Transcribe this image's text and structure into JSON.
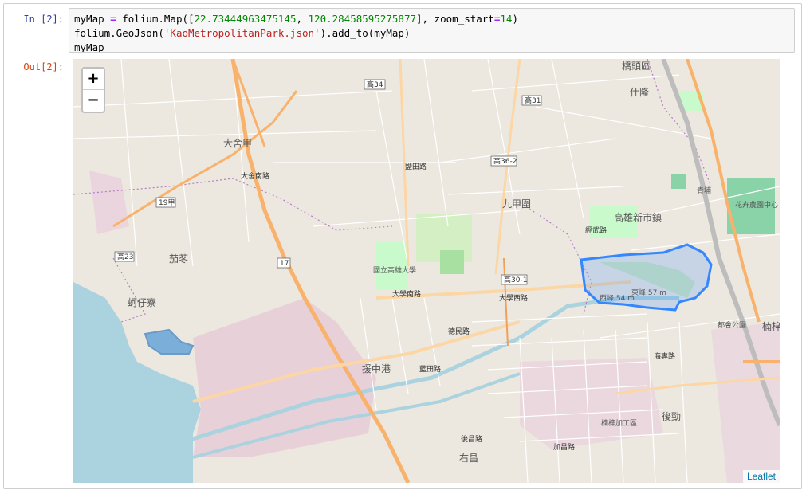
{
  "cell": {
    "in_prompt": "In [2]:",
    "out_prompt": "Out[2]:",
    "code_lines": [
      [
        {
          "t": "myMap ",
          "c": "var"
        },
        {
          "t": "=",
          "c": "kw-op"
        },
        {
          "t": " folium.Map([",
          "c": "var"
        },
        {
          "t": "22.73444963475145",
          "c": "num"
        },
        {
          "t": ", ",
          "c": "var"
        },
        {
          "t": "120.28458595275877",
          "c": "num"
        },
        {
          "t": "], zoom_start",
          "c": "var"
        },
        {
          "t": "=",
          "c": "kw-op"
        },
        {
          "t": "14",
          "c": "num"
        },
        {
          "t": ")",
          "c": "var"
        }
      ],
      [
        {
          "t": "folium.GeoJson(",
          "c": "var"
        },
        {
          "t": "'KaoMetropolitanPark.json'",
          "c": "str"
        },
        {
          "t": ").add_to(myMap)",
          "c": "var"
        }
      ],
      [
        {
          "t": "myMap",
          "c": "var"
        }
      ]
    ]
  },
  "map": {
    "zoom_in": "+",
    "zoom_out": "−",
    "attribution": "Leaflet",
    "colors": {
      "land": "#ece8df",
      "sea": "#aad3df",
      "geojson_fill": "#3388ff",
      "park": "#c8facc",
      "major_road": "#fcd6a4",
      "trunk_road": "#f9b26b"
    },
    "places": [
      {
        "id": "qiaotou",
        "text": "橋頭區"
      },
      {
        "id": "shiqian",
        "text": "仕隆"
      },
      {
        "id": "dasheju",
        "text": "大舍甲"
      },
      {
        "id": "jiujiawei",
        "text": "九甲圍"
      },
      {
        "id": "kaoshin",
        "text": "高雄新市鎮"
      },
      {
        "id": "nanzi_uni",
        "text": "國立高雄大學"
      },
      {
        "id": "jiadong",
        "text": "茄苳"
      },
      {
        "id": "kezailiao",
        "text": "蚵仔寮"
      },
      {
        "id": "houzhonggang",
        "text": "援中港"
      },
      {
        "id": "youchang",
        "text": "右昌"
      },
      {
        "id": "houjin",
        "text": "後勁"
      },
      {
        "id": "nanzi_export",
        "text": "楠梓加工區"
      },
      {
        "id": "duhui_park",
        "text": "都會公園"
      },
      {
        "id": "huahui",
        "text": "花卉農園中心"
      },
      {
        "id": "xifeng",
        "text": "西峰 54 m"
      },
      {
        "id": "dongfeng",
        "text": "東峰 57 m"
      },
      {
        "id": "qingpu",
        "text": "青埔"
      },
      {
        "id": "nanzi_right",
        "text": "楠梓"
      }
    ],
    "shields": [
      {
        "id": "s1",
        "text": "高34"
      },
      {
        "id": "s2",
        "text": "高31"
      },
      {
        "id": "s3",
        "text": "高36-2"
      },
      {
        "id": "s4",
        "text": "19甲"
      },
      {
        "id": "s5",
        "text": "高23"
      },
      {
        "id": "s6",
        "text": "17"
      },
      {
        "id": "s7",
        "text": "高30-1"
      }
    ],
    "roads": [
      {
        "id": "r1",
        "text": "大學南路"
      },
      {
        "id": "r2",
        "text": "大學西路"
      },
      {
        "id": "r3",
        "text": "德民路"
      },
      {
        "id": "r4",
        "text": "藍田路"
      },
      {
        "id": "r5",
        "text": "大舍南路"
      },
      {
        "id": "r6",
        "text": "鹽田路"
      },
      {
        "id": "r7",
        "text": "經武路"
      },
      {
        "id": "r8",
        "text": "後昌路"
      },
      {
        "id": "r9",
        "text": "海專路"
      },
      {
        "id": "r10",
        "text": "加昌路"
      }
    ]
  }
}
